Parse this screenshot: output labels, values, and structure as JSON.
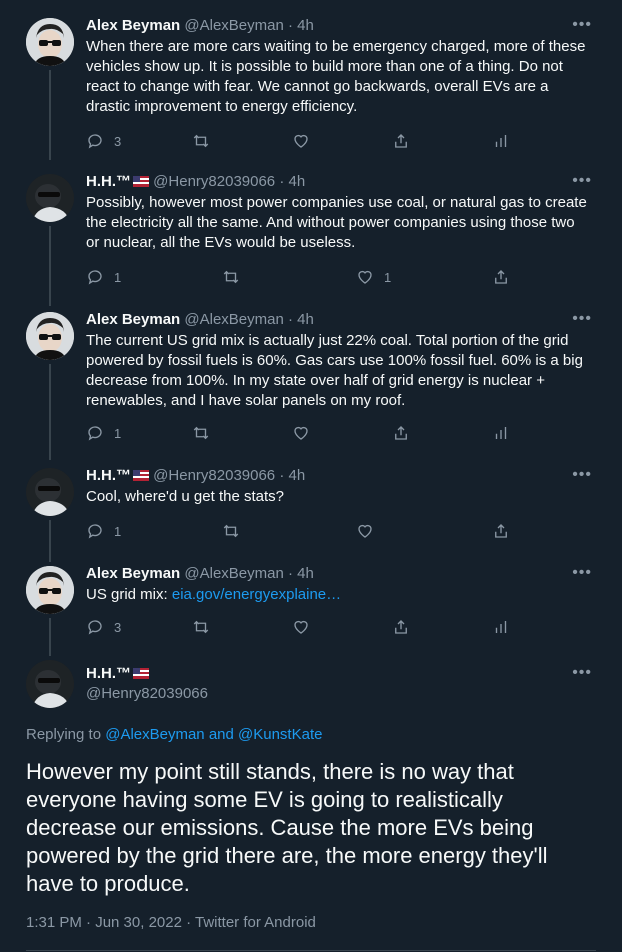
{
  "tweets": [
    {
      "name": "Alex Beyman",
      "handle": "@AlexBeyman",
      "time": "4h",
      "text": "When there are more cars waiting to be emergency charged, more of these vehicles show up. It is possible to build more than one of a thing. Do not react to change with fear. We cannot go backwards, overall EVs are a drastic improvement to energy efficiency.",
      "replies": "3"
    },
    {
      "name": "H.H.™",
      "handle": "@Henry82039066",
      "time": "4h",
      "text": "Possibly, however most power companies use coal, or natural gas to create the electricity all the same. And without power companies using those two or nuclear, all the EVs would be useless.",
      "replies": "1",
      "likes": "1"
    },
    {
      "name": "Alex Beyman",
      "handle": "@AlexBeyman",
      "time": "4h",
      "text": "The current US grid mix is actually just 22% coal. Total portion of the grid powered by fossil fuels is 60%. Gas cars use 100% fossil fuel. 60% is a big decrease from 100%. In my state over half of grid energy is nuclear + renewables, and I have solar panels on my roof.",
      "replies": "1"
    },
    {
      "name": "H.H.™",
      "handle": "@Henry82039066",
      "time": "4h",
      "text": "Cool, where'd u get the stats?",
      "replies": "1"
    },
    {
      "name": "Alex Beyman",
      "handle": "@AlexBeyman",
      "time": "4h",
      "text_prefix": "US grid mix: ",
      "link": "eia.gov/energyexplaine…",
      "replies": "3"
    }
  ],
  "main": {
    "name": "H.H.™",
    "handle": "@Henry82039066",
    "replying_prefix": "Replying to ",
    "replying_to": "@AlexBeyman and @KunstKate",
    "text": "However my point still stands, there is no way that everyone having some EV is going to realistically decrease our emissions. Cause the more EVs being powered by the grid there are, the more energy they'll have to produce.",
    "timestamp": "1:31 PM · Jun 30, 2022 · Twitter for Android"
  },
  "ui": {
    "separator": " · ",
    "more": "•••"
  }
}
